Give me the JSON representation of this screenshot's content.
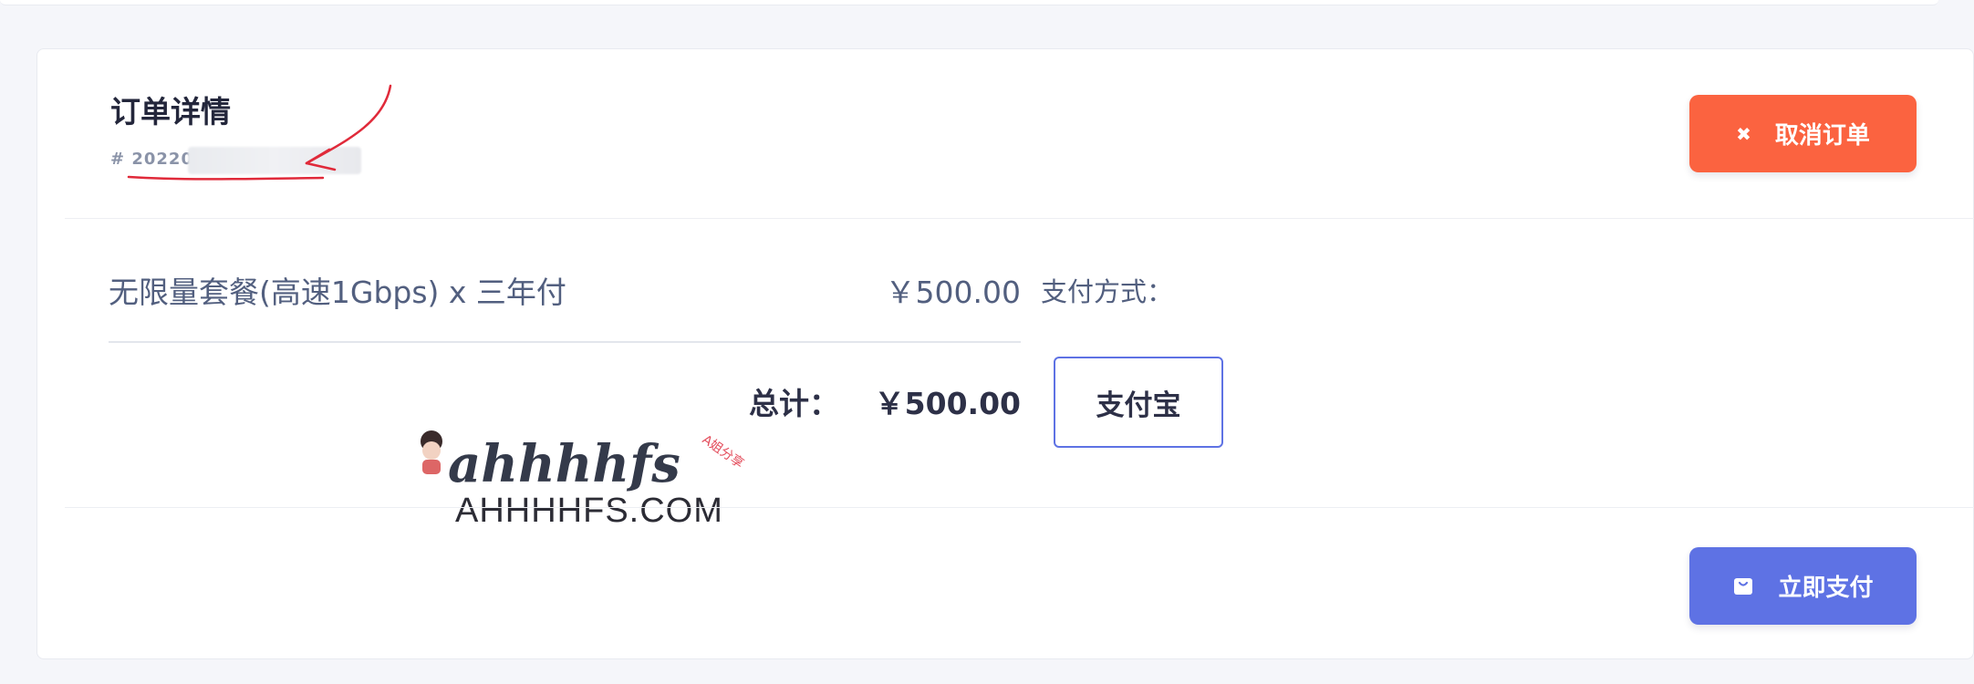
{
  "order": {
    "title": "订单详情",
    "number_prefix": "# 20220"
  },
  "actions": {
    "cancel_icon": "close-icon",
    "cancel_label": "取消订单",
    "pay_icon": "bag-icon",
    "pay_label": "立即支付"
  },
  "item": {
    "name": "无限量套餐(高速1Gbps) x 三年付",
    "price": "￥500.00"
  },
  "total": {
    "label": "总计：",
    "value": "￥500.00"
  },
  "payment": {
    "method_label": "支付方式：",
    "options": [
      "支付宝"
    ]
  },
  "watermark": {
    "logo_text": "ahhhhfs",
    "logo_tag": "A姐分享",
    "site": "AHHHHFS.COM"
  },
  "colors": {
    "cancel": "#fb6340",
    "primary": "#5e72e4",
    "annotation": "#e02a3a"
  }
}
